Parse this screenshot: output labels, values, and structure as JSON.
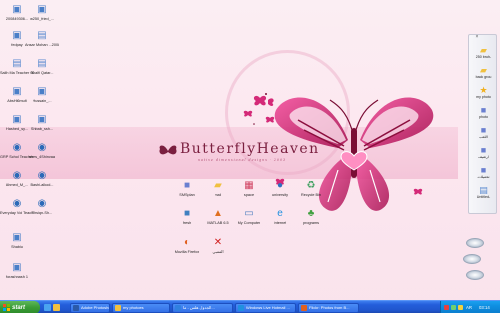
{
  "wallpaper": {
    "logo_text": "ButterflyHeaven",
    "tagline": "native dimensional designs · 2003"
  },
  "left_icons": [
    {
      "label": "200849306...",
      "icon": "image-file-icon"
    },
    {
      "label": "w250_fried_...",
      "icon": "image-file-icon"
    },
    {
      "label": "fedpay",
      "icon": "image-file-icon"
    },
    {
      "label": "Ansar Mohan ...2008 Ya HoldSelft",
      "icon": "document-icon"
    },
    {
      "label": "Salih Ma Teacher 00...",
      "icon": "document-icon"
    },
    {
      "label": "Shalfi Qatar...",
      "icon": "document-icon"
    },
    {
      "label": "AbsHi6mult",
      "icon": "image-file-icon"
    },
    {
      "label": "Hussain_...",
      "icon": "image-file-icon"
    },
    {
      "label": "Hashed_sy...",
      "icon": "image-file-icon"
    },
    {
      "label": "Shbab_ssh...",
      "icon": "image-file-icon"
    },
    {
      "label": "GRP Schol Teacher a...",
      "icon": "media-file-icon"
    },
    {
      "label": "shes_4Shinvaa",
      "icon": "media-file-icon"
    },
    {
      "label": "Ahmed_M_...",
      "icon": "media-file-icon"
    },
    {
      "label": "Bashi-alkod...",
      "icon": "media-file-icon"
    },
    {
      "label": "Everyday Voi Teacher ...",
      "icon": "media-file-icon"
    },
    {
      "label": "Thsiqn-Sh...",
      "icon": "media-file-icon"
    },
    {
      "label": "Shabiu",
      "icon": "image-file-icon"
    },
    {
      "label": "forashnash 1",
      "icon": "image-file-icon"
    }
  ],
  "center_icons": [
    {
      "label": "SMSplan",
      "icon": "app-icon",
      "color": "#6a7fd0"
    },
    {
      "label": "mail",
      "icon": "folder-icon",
      "color": "#f0c040"
    },
    {
      "label": "space",
      "icon": "blocks-icon",
      "color": "#d04060"
    },
    {
      "label": "university",
      "icon": "people-icon",
      "color": "#3070c0"
    },
    {
      "label": "Recycle Bin",
      "icon": "recycle-bin-icon",
      "color": "#40a060"
    },
    {
      "label": "fresh",
      "icon": "app-icon",
      "color": "#4080c0"
    },
    {
      "label": "MATLAB 6.5",
      "icon": "matlab-icon",
      "color": "#e07020"
    },
    {
      "label": "My Computer",
      "icon": "computer-icon",
      "color": "#5080c0"
    },
    {
      "label": "Internet",
      "icon": "internet-explorer-icon",
      "color": "#2090e0"
    },
    {
      "label": "programs",
      "icon": "tree-icon",
      "color": "#40a040"
    },
    {
      "label": "Mozilla Firefox",
      "icon": "firefox-icon",
      "color": "#e06020"
    },
    {
      "label": "المتنبي",
      "icon": "red-x-icon",
      "color": "#d02020"
    }
  ],
  "quickbar": {
    "items": [
      {
        "label": "250 bruh-",
        "icon": "folder-icon"
      },
      {
        "label": "back grou",
        "icon": "folder-icon"
      },
      {
        "label": "my photo",
        "icon": "star-icon"
      },
      {
        "label": "photo",
        "icon": "app-icon"
      },
      {
        "label": "اللعب",
        "icon": "app-icon"
      },
      {
        "label": "ارشيف",
        "icon": "app-icon"
      },
      {
        "label": "تحميلات",
        "icon": "app-icon"
      },
      {
        "label": "Untitled-",
        "icon": "document-icon"
      }
    ]
  },
  "taskbar": {
    "start_label": "start",
    "tasks": [
      {
        "label": "Adobe Photoshop",
        "color": "#2b5aa8"
      },
      {
        "label": "my photoes",
        "color": "#f0c040"
      },
      {
        "label": "الجدول هلس - ما...",
        "color": "#3080e0"
      },
      {
        "label": "Windows Live Hotmail ...",
        "color": "#2090e0"
      },
      {
        "label": "Flickr: Photos from B...",
        "color": "#e06020"
      }
    ],
    "tray_time": "03:14",
    "tray_lang": "AR"
  },
  "colors": {
    "taskbar_blue": "#245edb",
    "start_green": "#3a9c35",
    "tray_blue": "#0f8ee0",
    "wallpaper_pink": "#fbeef3",
    "butterfly_magenta": "#d42a78"
  }
}
